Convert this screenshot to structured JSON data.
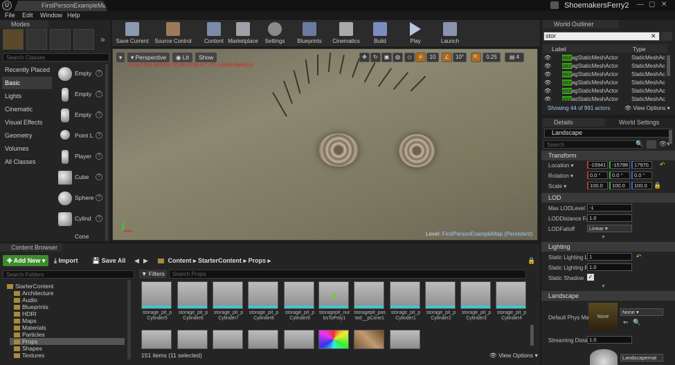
{
  "window": {
    "doc_tab": "FirstPersonExampleMap*",
    "project": "ShoemakersFerry2"
  },
  "menu": [
    "File",
    "Edit",
    "Window",
    "Help"
  ],
  "modes": {
    "tab": "Modes",
    "search_placeholder": "Search Classes",
    "categories": [
      "Recently Placed",
      "Basic",
      "Lights",
      "Cinematic",
      "Visual Effects",
      "Geometry",
      "Volumes",
      "All Classes"
    ],
    "items": [
      "Empty",
      "Empty",
      "Empty",
      "Point L",
      "Player",
      "Cube",
      "Sphere",
      "Cylind",
      "Cone"
    ]
  },
  "toolbar": [
    "Save Current",
    "Source Control",
    "Content",
    "Marketplace",
    "Settings",
    "Blueprints",
    "Cinematics",
    "Build",
    "Play",
    "Launch"
  ],
  "viewport": {
    "perspective": "Perspective",
    "lit": "Lit",
    "show": "Show",
    "warning": "LIGHTING NEEDS TO BE REBUILT (75 unbuilt object(s))",
    "snap_grid": "10",
    "snap_rot": "10°",
    "snap_scale": "0.25",
    "cam_speed": "4",
    "level_label": "Level:",
    "level_name": "FirstPersonExampleMap (Persistent)"
  },
  "outliner": {
    "tab": "World Outliner",
    "search_value": "stor",
    "col_label": "Label",
    "col_type": "Type",
    "rows": [
      {
        "hl": "stor",
        "rest": "agStaticMeshActor",
        "type": "StaticMeshAc"
      },
      {
        "hl": "stor",
        "rest": "agStaticMeshActor",
        "type": "StaticMeshAc"
      },
      {
        "hl": "stor",
        "rest": "agStaticMeshActor",
        "type": "StaticMeshAc"
      },
      {
        "hl": "stor",
        "rest": "agStaticMeshActor",
        "type": "StaticMeshAc"
      },
      {
        "hl": "stor",
        "rest": "agStaticMeshActor",
        "type": "StaticMeshAc"
      },
      {
        "hl": "stor",
        "rest": "agStaticMeshActor",
        "type": "StaticMeshAc"
      }
    ],
    "status": "Showing 44 of 991 actors",
    "view_options": "View Options"
  },
  "details": {
    "tab": "Details",
    "tab2": "World Settings",
    "object_name": "Landscape",
    "search_placeholder": "Search",
    "transform": {
      "header": "Transform",
      "location_label": "Location",
      "rotation_label": "Rotation",
      "scale_label": "Scale",
      "location": [
        "-15941",
        "-15786",
        "17970."
      ],
      "rotation": [
        "0.0 °",
        "0.0 °",
        "0.0 °"
      ],
      "scale": [
        "100.0",
        "100.0",
        "100.0"
      ]
    },
    "lod": {
      "header": "LOD",
      "lod_level_label": "Max LODLevel",
      "lod_level": "-1",
      "lod_dist_label": "LODDistance Fa",
      "lod_dist": "1.0",
      "falloff_label": "LODFalloff",
      "falloff": "Linear"
    },
    "lighting": {
      "header": "Lighting",
      "sl1_label": "Static Lighting L",
      "sl1": "1",
      "sl2_label": "Static Lighting R",
      "sl2": "1.0",
      "shadow_label": "Static Shadow"
    },
    "landscape": {
      "header": "Landscape",
      "phys_label": "Default Phys Ma",
      "phys_thumb": "None",
      "phys_value": "None",
      "stream_label": "Streaming Dista",
      "stream_value": "1.0",
      "material": "Landscapemat"
    }
  },
  "content_browser": {
    "tab": "Content Browser",
    "add_new": "Add New",
    "import": "Import",
    "save_all": "Save All",
    "path": [
      "Content",
      "StarterContent",
      "Props"
    ],
    "folder_search": "Search Folders",
    "filters": "Filters",
    "asset_search": "Search Props",
    "tree": [
      "StarterContent",
      "Architecture",
      "Audio",
      "Blueprints",
      "HDRI",
      "Maps",
      "Materials",
      "Particles",
      "Props",
      "Shapes",
      "Textures"
    ],
    "assets": [
      "storage_pit_pCylinder5",
      "storage_pit_pCylinder6",
      "storage_pit_pCylinder7",
      "storage_pit_pCylinder8",
      "storage_pit_pCylinder9",
      "storagepit_nurbsToPoly1",
      "storagepit_pasted__pCone1",
      "storage_pit_pCylinder1",
      "storage_pit_pCylinder2",
      "storage_pit_pCylinder3",
      "storage_pit_pCylinder4"
    ],
    "status": "151 items (11 selected)",
    "view_options": "View Options"
  }
}
